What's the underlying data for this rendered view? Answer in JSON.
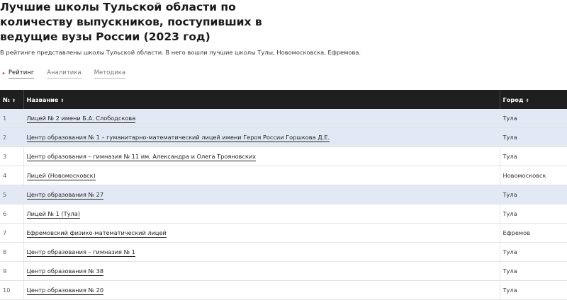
{
  "header": {
    "title": "Лучшие школы Тульской области по количеству выпускников, поступивших в ведущие вузы России (2023 год)",
    "intro": "В рейтинге представлены школы Тульской области. В него вошли лучшие школы Тулы, Новомосковска, Ефремова."
  },
  "tabs": [
    {
      "label": "Рейтинг",
      "active": true
    },
    {
      "label": "Аналитика",
      "active": false
    },
    {
      "label": "Методика",
      "active": false
    }
  ],
  "table": {
    "columns": [
      "№",
      "Название",
      "Город"
    ],
    "sort_icon": "⇕",
    "rows": [
      {
        "num": "1",
        "name": "Лицей № 2 имени Б.А. Слободскова",
        "city": "Тула",
        "highlighted": true
      },
      {
        "num": "2",
        "name": "Центр образования № 1 – гуманитарно-математический лицей имени Героя России Горшкова Д.Е.",
        "city": "Тула",
        "highlighted": true
      },
      {
        "num": "3",
        "name": "Центр образования – гимназия № 11 им. Александра и Олега Трояновских",
        "city": "Тула",
        "highlighted": false
      },
      {
        "num": "4",
        "name": "Лицей (Новомосковск)",
        "city": "Новомосковск",
        "highlighted": false
      },
      {
        "num": "5",
        "name": "Центр образования № 27",
        "city": "Тула",
        "highlighted": true
      },
      {
        "num": "6",
        "name": "Лицей № 1 (Тула)",
        "city": "Тула",
        "highlighted": false
      },
      {
        "num": "7",
        "name": "Ефремовский физико-математический лицей",
        "city": "Ефремов",
        "highlighted": false
      },
      {
        "num": "8",
        "name": "Центр образования – гимназия № 1",
        "city": "Тула",
        "highlighted": false
      },
      {
        "num": "9",
        "name": "Центр образования № 38",
        "city": "Тула",
        "highlighted": false
      },
      {
        "num": "10",
        "name": "Центр образования № 20",
        "city": "Тула",
        "highlighted": false
      }
    ]
  },
  "colors": {
    "header_bg": "#1f1f1f",
    "highlight_row": "#e3e9f4",
    "active_dot": "#e53935"
  }
}
